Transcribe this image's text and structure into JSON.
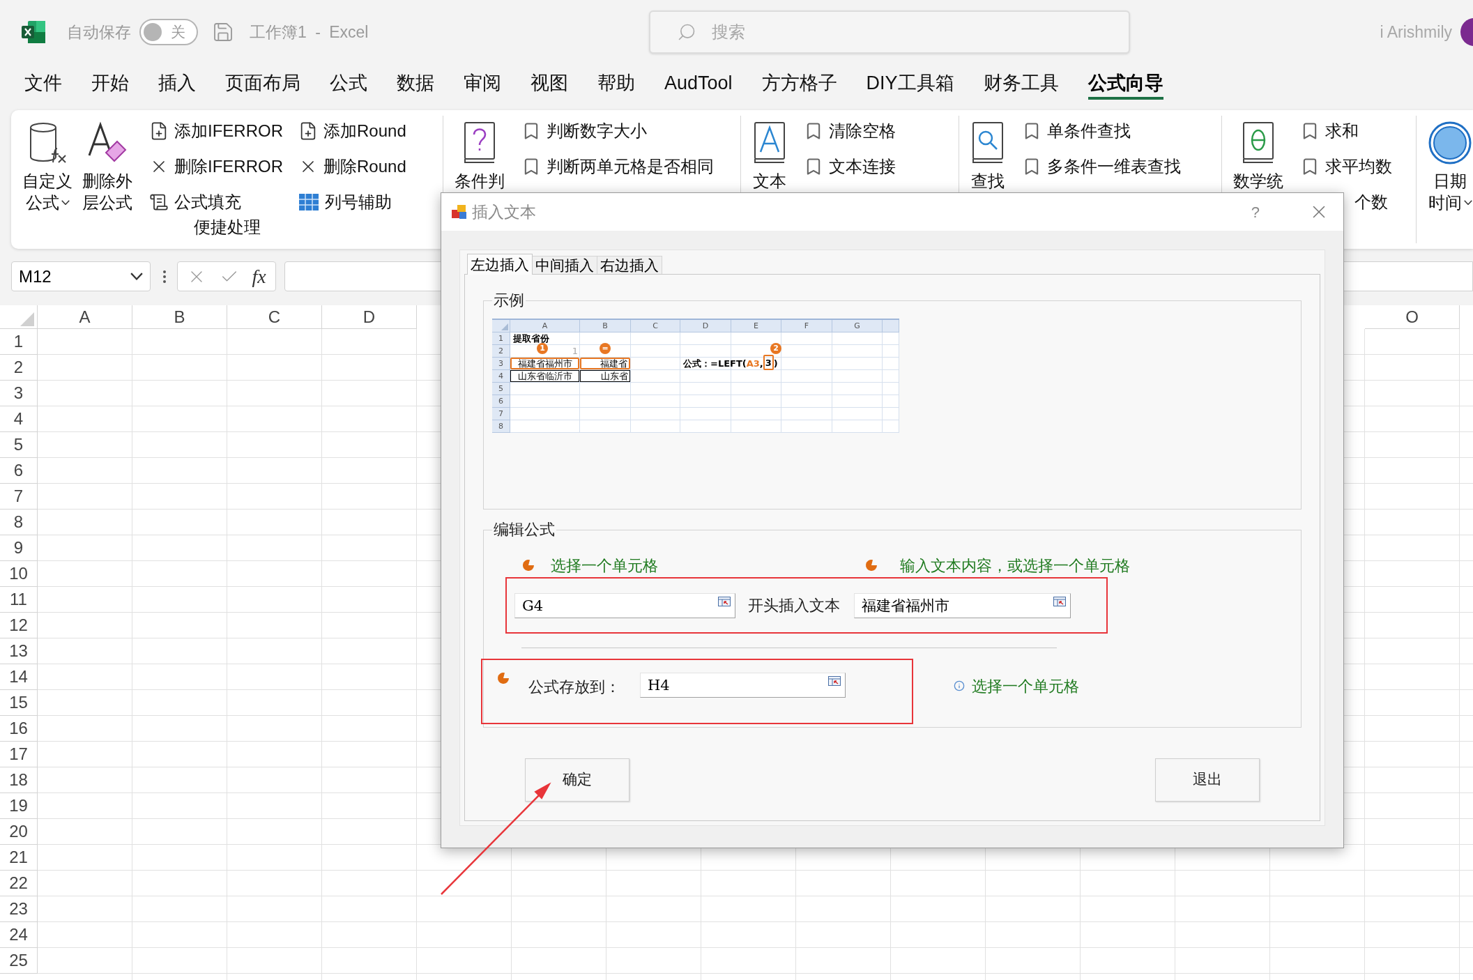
{
  "title_bar": {
    "autosave_label": "自动保存",
    "autosave": {
      "on": false,
      "state_text": "关"
    },
    "document_title": "工作簿1 - Excel",
    "search": {
      "placeholder": "搜索"
    },
    "user_name": "i Arishmily"
  },
  "ribbon_tabs": [
    {
      "label": "文件",
      "selected": false
    },
    {
      "label": "开始",
      "selected": false
    },
    {
      "label": "插入",
      "selected": false
    },
    {
      "label": "页面布局",
      "selected": false
    },
    {
      "label": "公式",
      "selected": false
    },
    {
      "label": "数据",
      "selected": false
    },
    {
      "label": "审阅",
      "selected": false
    },
    {
      "label": "视图",
      "selected": false
    },
    {
      "label": "帮助",
      "selected": false
    },
    {
      "label": "AudTool",
      "selected": false
    },
    {
      "label": "方方格子",
      "selected": false
    },
    {
      "label": "DIY工具箱",
      "selected": false
    },
    {
      "label": "财务工具",
      "selected": false
    },
    {
      "label": "公式向导",
      "selected": true
    }
  ],
  "ribbon": {
    "groups": [
      {
        "label": "便捷处理",
        "large": [
          {
            "lines": [
              "自定义",
              "公式"
            ],
            "dropdown": true
          },
          {
            "lines": [
              "删除外",
              "层公式"
            ],
            "dropdown": false
          }
        ],
        "small": [
          {
            "label": "添加IFERROR"
          },
          {
            "label": "删除IFERROR"
          },
          {
            "label": "公式填充"
          },
          {
            "label": "添加Round"
          },
          {
            "label": "删除Round"
          },
          {
            "label": "列号辅助"
          }
        ]
      },
      {
        "large": [
          {
            "lines": [
              "条件判"
            ],
            "dropdown": false
          }
        ],
        "small": [
          {
            "label": "判断数字大小"
          },
          {
            "label": "判断两单元格是否相同"
          }
        ]
      },
      {
        "large": [
          {
            "lines": [
              "文本"
            ],
            "dropdown": false
          }
        ],
        "small": [
          {
            "label": "清除空格"
          },
          {
            "label": "文本连接"
          }
        ]
      },
      {
        "large": [
          {
            "lines": [
              "查找"
            ],
            "dropdown": false
          }
        ],
        "small": [
          {
            "label": "单条件查找"
          },
          {
            "label": "多条件一维表查找"
          }
        ]
      },
      {
        "large": [
          {
            "lines": [
              "数学统"
            ],
            "dropdown": false
          }
        ],
        "small": [
          {
            "label": "求和"
          },
          {
            "label": "求平均数"
          },
          {
            "label": "个数"
          }
        ]
      },
      {
        "large": [
          {
            "lines": [
              "日期",
              "时间"
            ],
            "dropdown": true
          }
        ]
      }
    ]
  },
  "formula_bar": {
    "name_box": "M12",
    "fx": "fx"
  },
  "sheet": {
    "columns_left": [
      "A",
      "B",
      "C",
      "D"
    ],
    "columns_right": [
      "O"
    ],
    "rows": [
      "1",
      "2",
      "3",
      "4",
      "5",
      "6",
      "7",
      "8",
      "9",
      "10",
      "11",
      "12",
      "13",
      "14",
      "15",
      "16",
      "17",
      "18",
      "19",
      "20",
      "21",
      "22",
      "23",
      "24",
      "25"
    ]
  },
  "dialog": {
    "title": "插入文本",
    "help": "?",
    "tabs": [
      {
        "label": "左边插入",
        "selected": true
      },
      {
        "label": "中间插入",
        "selected": false
      },
      {
        "label": "右边插入",
        "selected": false
      }
    ],
    "example": {
      "label": "示例",
      "columns": [
        "A",
        "B",
        "C",
        "D",
        "E",
        "F",
        "G"
      ],
      "rows": [
        "1",
        "2",
        "3",
        "4",
        "5",
        "6",
        "7",
        "8"
      ],
      "title_cell": "提取省份",
      "faint_value": "1",
      "sources": [
        "福建省福州市",
        "山东省临沂市"
      ],
      "results": [
        "福建省",
        "山东省"
      ],
      "markers": [
        "1",
        "=",
        "2"
      ],
      "formula_parts": [
        {
          "text": "公式：=LEFT(",
          "kind": "plain"
        },
        {
          "text": "A3",
          "kind": "ref"
        },
        {
          "text": ",",
          "kind": "plain"
        },
        {
          "text": "3",
          "kind": "boxed"
        },
        {
          "text": ")",
          "kind": "plain"
        }
      ]
    },
    "edit": {
      "label": "编辑公式",
      "hints": [
        "选择一个单元格",
        "输入文本内容，或选择一个单元格"
      ],
      "source_field": {
        "value": "G4"
      },
      "insert_label": "开头插入文本",
      "text_field": {
        "value": "福建省福州市"
      },
      "target_label": "公式存放到：",
      "target_field": {
        "value": "H4"
      },
      "target_hint": "选择一个单元格"
    },
    "buttons": [
      "确定",
      "退出"
    ]
  }
}
